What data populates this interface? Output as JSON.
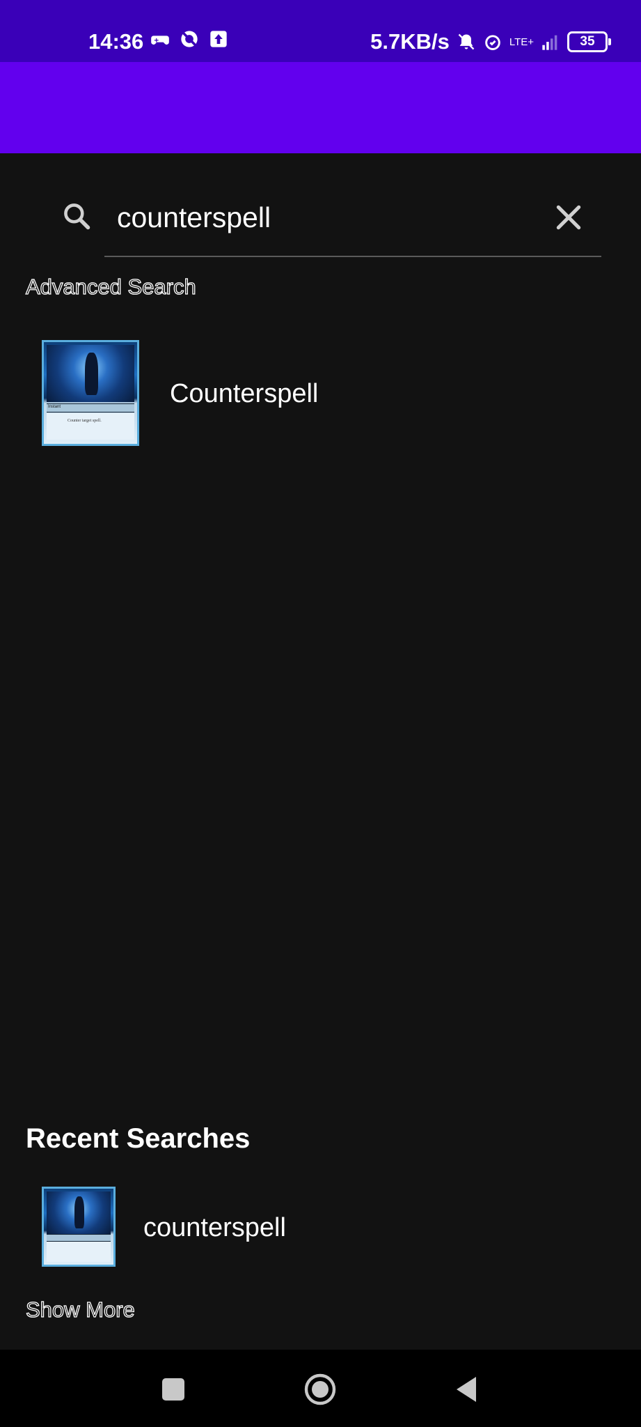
{
  "status_bar": {
    "time": "14:36",
    "speed": "5.7KB/s",
    "network": "LTE+",
    "battery": "35"
  },
  "search": {
    "query": "counterspell",
    "advanced_label": "Advanced Search"
  },
  "results": [
    {
      "label": "Counterspell",
      "thumb_type": "Instant",
      "thumb_text": "Counter target spell."
    }
  ],
  "recent": {
    "title": "Recent Searches",
    "items": [
      {
        "label": "counterspell"
      }
    ],
    "show_more_label": "Show More"
  },
  "colors": {
    "status_bar": "#3a00b8",
    "app_bar": "#6200ee",
    "background": "#121212"
  },
  "icons": {
    "search": "search-icon",
    "clear": "close-icon",
    "nav_recents": "square-icon",
    "nav_home": "circle-icon",
    "nav_back": "triangle-back-icon"
  }
}
